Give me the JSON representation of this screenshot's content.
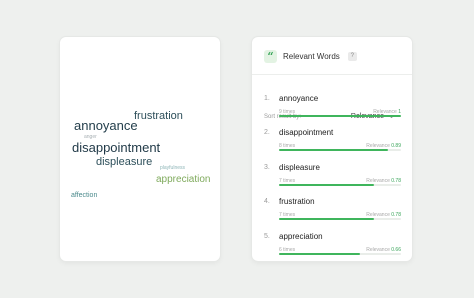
{
  "word_cloud": {
    "words": [
      {
        "text": "frustration",
        "color": "#2d4f5a"
      },
      {
        "text": "annoyance",
        "color": "#243f4c"
      },
      {
        "text": "anger",
        "color": "#a8b0b4"
      },
      {
        "text": "disappointment",
        "color": "#1f3846"
      },
      {
        "text": "displeasure",
        "color": "#2d4f5a"
      },
      {
        "text": "playfulness",
        "color": "#8fb6b8"
      },
      {
        "text": "appreciation",
        "color": "#7faa5c"
      },
      {
        "text": "affection",
        "color": "#4b8a8c"
      }
    ]
  },
  "relevant_words": {
    "title": "Relevant Words",
    "icon": "quote-icon",
    "help_label": "?",
    "sort_label": "Sort result by:",
    "sort_value": "Relevance",
    "relevance_prefix": "Relevance",
    "items": [
      {
        "rank": "1.",
        "word": "annoyance",
        "times": "9 times",
        "relevance_label": "1",
        "relevance": 1.0
      },
      {
        "rank": "2.",
        "word": "disappointment",
        "times": "8 times",
        "relevance_label": "0.89",
        "relevance": 0.89
      },
      {
        "rank": "3.",
        "word": "displeasure",
        "times": "7 times",
        "relevance_label": "0.78",
        "relevance": 0.78
      },
      {
        "rank": "4.",
        "word": "frustration",
        "times": "7 times",
        "relevance_label": "0.78",
        "relevance": 0.78
      },
      {
        "rank": "5.",
        "word": "appreciation",
        "times": "6 times",
        "relevance_label": "0.66",
        "relevance": 0.66
      }
    ],
    "accent_color": "#3fb55c"
  }
}
